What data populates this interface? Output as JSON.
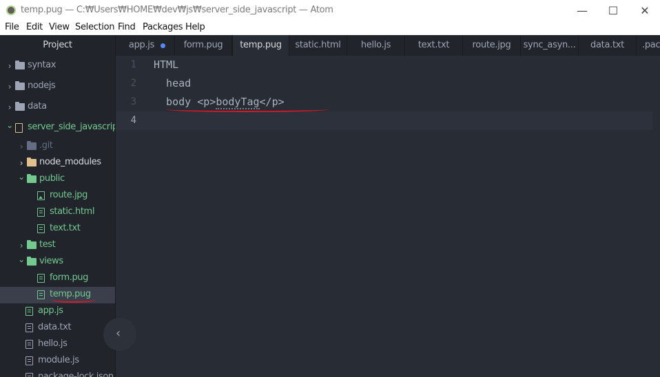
{
  "window": {
    "title": "temp.pug — C:₩Users₩HOME₩dev₩js₩server_side_javascript — Atom",
    "controls": {
      "minimize": "—",
      "maximize": "☐",
      "close": "✕"
    }
  },
  "menu": [
    "File",
    "Edit",
    "View",
    "Selection",
    "Find",
    "Packages",
    "Help"
  ],
  "sidebar": {
    "title": "Project",
    "collapse_glyph": "‹",
    "items": [
      {
        "label": "syntax",
        "type": "folder",
        "expanded": false,
        "color": "#9da5b4"
      },
      {
        "label": "nodejs",
        "type": "folder",
        "expanded": false,
        "color": "#9da5b4"
      },
      {
        "label": "data",
        "type": "folder",
        "expanded": false,
        "color": "#9da5b4"
      },
      {
        "label": "server_side_javascript",
        "type": "repo",
        "expanded": true,
        "color": "#73c990"
      },
      {
        "label": ".git",
        "type": "folder",
        "expanded": false,
        "color": "#636d83"
      },
      {
        "label": "node_modules",
        "type": "folder",
        "expanded": false,
        "color": "#d7dae0",
        "icon_color": "#e2c08d"
      },
      {
        "label": "public",
        "type": "folder",
        "expanded": true,
        "color": "#73c990"
      },
      {
        "label": "route.jpg",
        "type": "image",
        "color": "#73c990"
      },
      {
        "label": "static.html",
        "type": "file",
        "color": "#73c990"
      },
      {
        "label": "text.txt",
        "type": "file",
        "color": "#73c990"
      },
      {
        "label": "test",
        "type": "folder",
        "expanded": false,
        "color": "#73c990"
      },
      {
        "label": "views",
        "type": "folder",
        "expanded": true,
        "color": "#73c990"
      },
      {
        "label": "form.pug",
        "type": "file",
        "color": "#73c990"
      },
      {
        "label": "temp.pug",
        "type": "file",
        "color": "#73c990",
        "selected": true
      },
      {
        "label": "app.js",
        "type": "file",
        "color": "#73c990"
      },
      {
        "label": "data.txt",
        "type": "file",
        "color": "#9da5b4"
      },
      {
        "label": "hello.js",
        "type": "file",
        "color": "#9da5b4"
      },
      {
        "label": "module.js",
        "type": "file",
        "color": "#9da5b4"
      },
      {
        "label": "package-lock.json",
        "type": "file",
        "color": "#9da5b4"
      }
    ]
  },
  "tabs": [
    {
      "label": "app.js",
      "modified": true,
      "active": false
    },
    {
      "label": "form.pug",
      "active": false
    },
    {
      "label": "temp.pug",
      "active": true
    },
    {
      "label": "static.html",
      "active": false
    },
    {
      "label": "hello.js",
      "active": false
    },
    {
      "label": "text.txt",
      "active": false
    },
    {
      "label": "route.jpg",
      "active": false
    },
    {
      "label": "sync_asyn...",
      "active": false
    },
    {
      "label": "data.txt",
      "active": false
    },
    {
      "label": ".pack",
      "active": false
    }
  ],
  "editor": {
    "line_numbers": [
      "1",
      "2",
      "3",
      "4"
    ],
    "lines": {
      "l1": "HTML",
      "l2": "  head",
      "l3_text": "  body ",
      "l3_open": "<p>",
      "l3_content": "bodyTag",
      "l3_close": "</p>",
      "l4": ""
    },
    "annotation_color": "#d11a2a"
  }
}
